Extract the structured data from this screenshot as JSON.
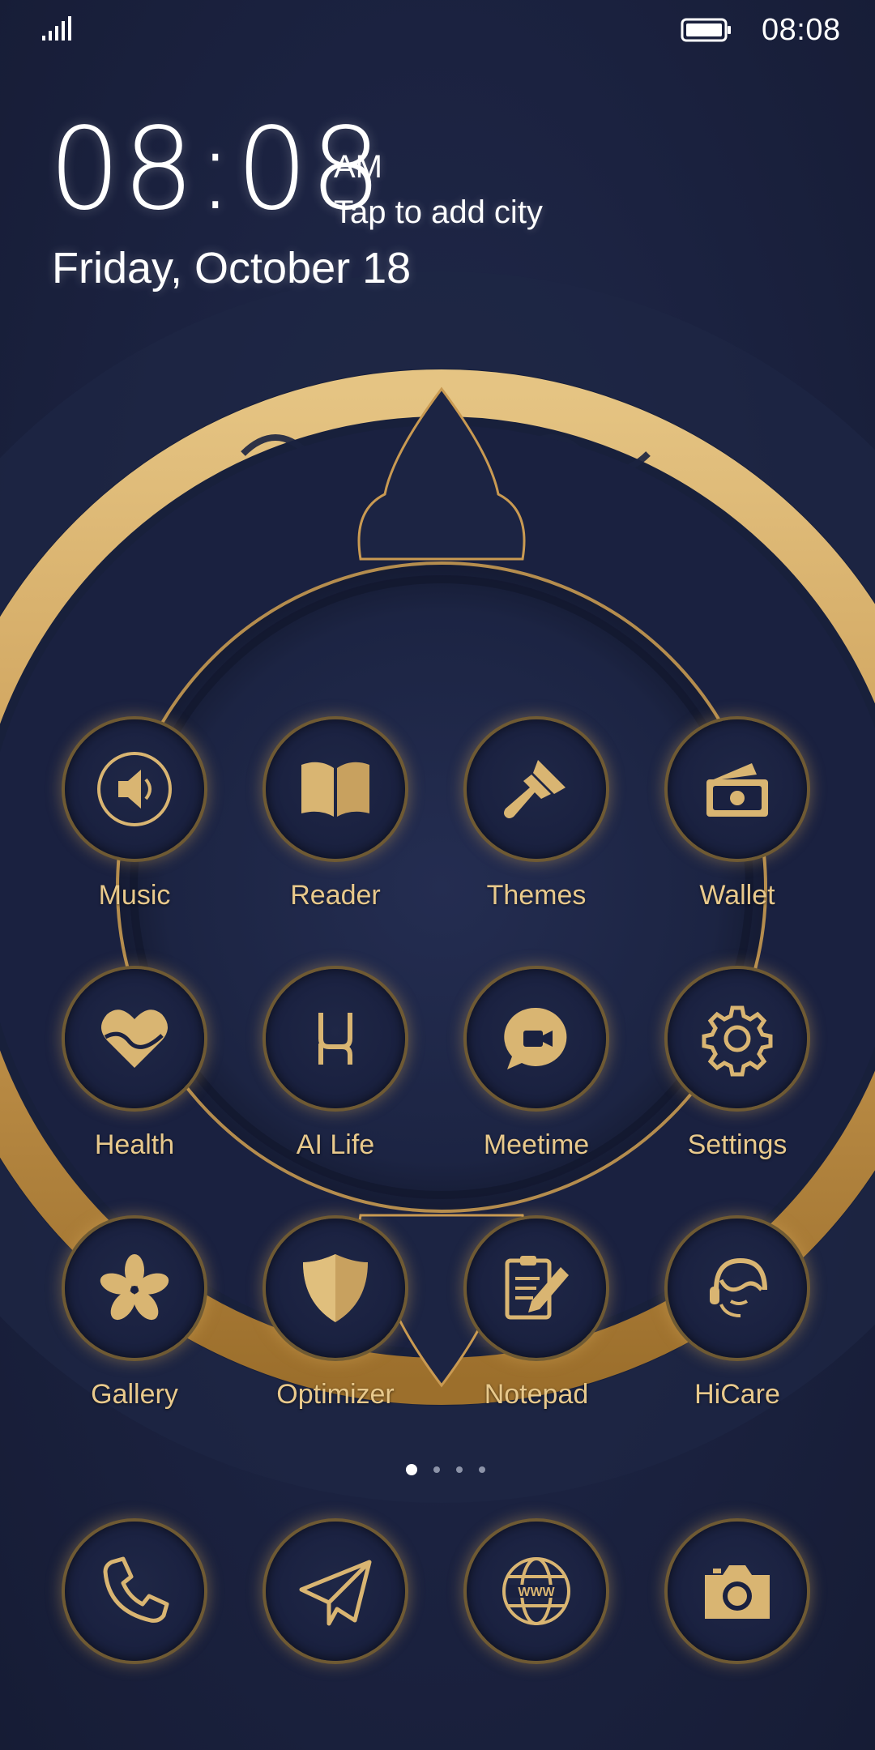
{
  "status_bar": {
    "time": "08:08",
    "signal_icon": "signal-bars-icon",
    "battery_icon": "battery-full-icon"
  },
  "clock_widget": {
    "time": "08:08",
    "ampm": "AM",
    "city_prompt": "Tap to add city",
    "date": "Friday, October 18"
  },
  "theme": {
    "accent": "#d9b572",
    "label_color": "#e8c98c",
    "background": "#1c2340"
  },
  "apps": [
    {
      "label": "Music",
      "icon": "speaker-icon"
    },
    {
      "label": "Reader",
      "icon": "open-book-icon"
    },
    {
      "label": "Themes",
      "icon": "paint-brush-icon"
    },
    {
      "label": "Wallet",
      "icon": "wallet-icon"
    },
    {
      "label": "Health",
      "icon": "heart-icon"
    },
    {
      "label": "AI Life",
      "icon": "ai-life-icon"
    },
    {
      "label": "Meetime",
      "icon": "video-chat-icon"
    },
    {
      "label": "Settings",
      "icon": "gear-icon"
    },
    {
      "label": "Gallery",
      "icon": "flower-icon"
    },
    {
      "label": "Optimizer",
      "icon": "shield-icon"
    },
    {
      "label": "Notepad",
      "icon": "notepad-pencil-icon"
    },
    {
      "label": "HiCare",
      "icon": "headset-icon"
    }
  ],
  "page_indicator": {
    "total": 4,
    "current": 1
  },
  "dock": [
    {
      "icon": "phone-icon"
    },
    {
      "icon": "paper-plane-icon"
    },
    {
      "icon": "globe-www-icon"
    },
    {
      "icon": "camera-icon"
    }
  ],
  "dock_globe_text": "WWW"
}
